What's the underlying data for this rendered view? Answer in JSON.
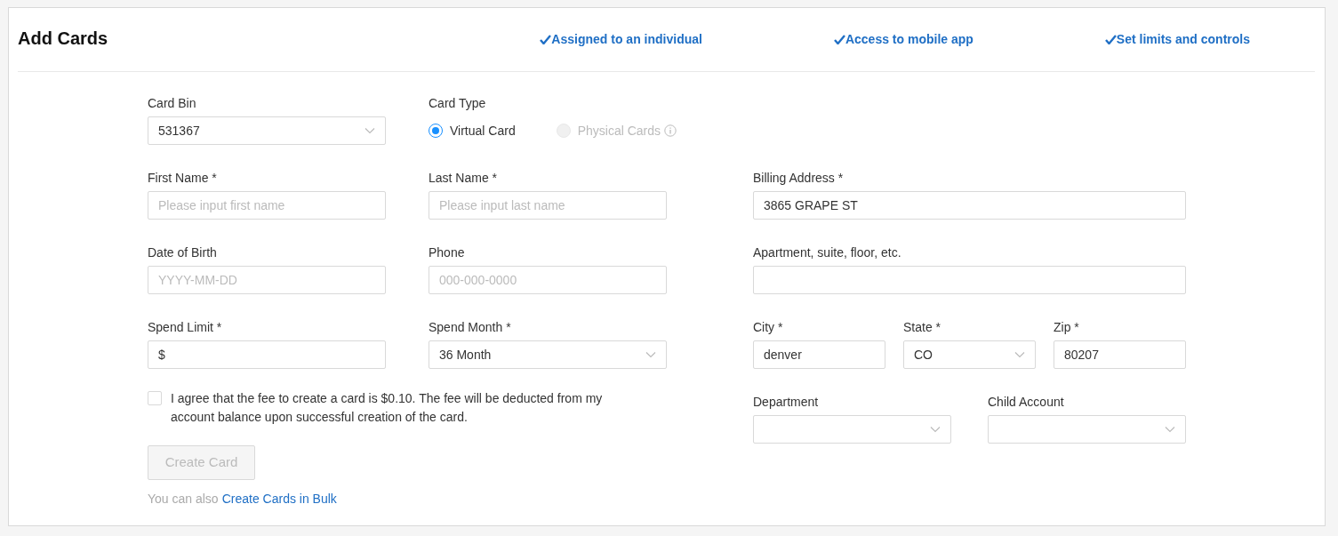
{
  "title": "Add Cards",
  "features": [
    {
      "label": "Assigned to an individual"
    },
    {
      "label": "Access to mobile app"
    },
    {
      "label": "Set limits and controls"
    }
  ],
  "rows": [
    {
      "left": [
        {
          "kind": "select",
          "label": "Card Bin",
          "value": "531367"
        },
        {
          "kind": "radio",
          "label": "Card Type",
          "options": [
            {
              "label": "Virtual Card",
              "selected": true,
              "disabled": false,
              "info": false
            },
            {
              "label": "Physical Cards",
              "selected": false,
              "disabled": true,
              "info": true
            }
          ]
        }
      ],
      "right": []
    },
    {
      "left": [
        {
          "kind": "text",
          "label": "First Name *",
          "placeholder": "Please input first name"
        },
        {
          "kind": "text",
          "label": "Last Name *",
          "placeholder": "Please input last name"
        }
      ],
      "right": [
        {
          "kind": "text",
          "label": "Billing Address *",
          "value": "3865 GRAPE ST"
        }
      ]
    },
    {
      "left": [
        {
          "kind": "text",
          "label": "Date of Birth",
          "placeholder": "YYYY-MM-DD"
        },
        {
          "kind": "text",
          "label": "Phone",
          "placeholder": "000-000-0000"
        }
      ],
      "right": [
        {
          "kind": "text",
          "label": "Apartment, suite, floor, etc."
        }
      ]
    },
    {
      "left": [
        {
          "kind": "text",
          "label": "Spend Limit *",
          "value": "$"
        },
        {
          "kind": "select",
          "label": "Spend Month *",
          "value": "36 Month"
        }
      ],
      "right": [
        {
          "kind": "text",
          "label": "City *",
          "value": "denver"
        },
        {
          "kind": "select",
          "label": "State *",
          "value": "CO"
        },
        {
          "kind": "text",
          "label": "Zip *",
          "value": "80207"
        }
      ]
    }
  ],
  "agreement": {
    "text": "I agree that the fee to create a card is $0.10. The fee will be deducted from my account balance upon successful creation of the card.",
    "checked": false
  },
  "create_button": {
    "label": "Create Card",
    "disabled": true
  },
  "bulk": {
    "text": "You can also",
    "link": "Create Cards in Bulk"
  },
  "extra_fields": [
    {
      "kind": "select",
      "label": "Department"
    },
    {
      "kind": "select",
      "label": "Child Account"
    }
  ]
}
